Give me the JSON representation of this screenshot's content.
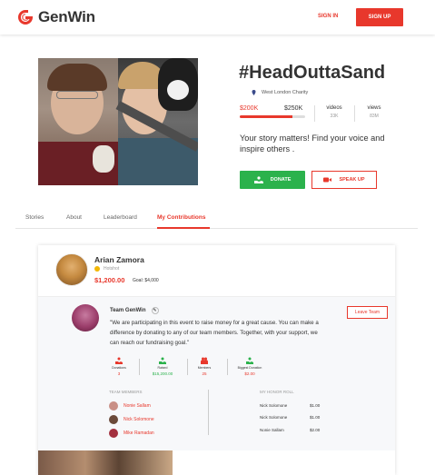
{
  "header": {
    "brand": "GenWin",
    "signin_label": "SIGN IN",
    "signup_label": "SIGN UP"
  },
  "campaign": {
    "title": "#HeadOuttaSand",
    "charity": "West London Charity",
    "raised": "$200K",
    "goal": "$250K",
    "progress_fraction": 0.8,
    "videos_label": "videos",
    "videos_value": "33K",
    "views_label": "views",
    "views_value": "83M",
    "story": "Your story matters! Find your voice and inspire others .",
    "donate_label": "DONATE",
    "speak_label": "SPEAK UP"
  },
  "tabs": [
    {
      "label": "Stories"
    },
    {
      "label": "About"
    },
    {
      "label": "Leaderboard"
    },
    {
      "label": "My Contributions"
    }
  ],
  "contribution": {
    "user_name": "Arian Zamora",
    "status": "Hotshot",
    "amount": "$1,200.00",
    "goal": "Goal: $4,000"
  },
  "team": {
    "name": "Team GenWin",
    "quote": "\"We are participating in this event to raise money for a great cause. You can make a difference by donating to any of our team members. Together, with your support, we can reach our fundraising goal.\"",
    "leave_label": "Leave Team",
    "stats": [
      {
        "label": "Donations",
        "value": "3"
      },
      {
        "label": "Raised",
        "value": "$15,200.00"
      },
      {
        "label": "Members",
        "value": "25"
      },
      {
        "label": "Biggest Donation",
        "value": "$2.00"
      }
    ],
    "members_title": "TEAM MEMBERS",
    "members": [
      {
        "name": "Nonie Sallam"
      },
      {
        "name": "Nick Solomone"
      },
      {
        "name": "Mike Ramadan"
      }
    ],
    "honor_title": "MY HONOR ROLL",
    "honor_roll": [
      {
        "name": "Nick Solomone",
        "amount": "$1.00"
      },
      {
        "name": "Nick Solomone",
        "amount": "$1.00"
      },
      {
        "name": "Nonie Sallam",
        "amount": "$2.00"
      }
    ]
  },
  "colors": {
    "accent": "#e8382c",
    "success": "#2bb24c",
    "hotshot": "#f2b705"
  }
}
